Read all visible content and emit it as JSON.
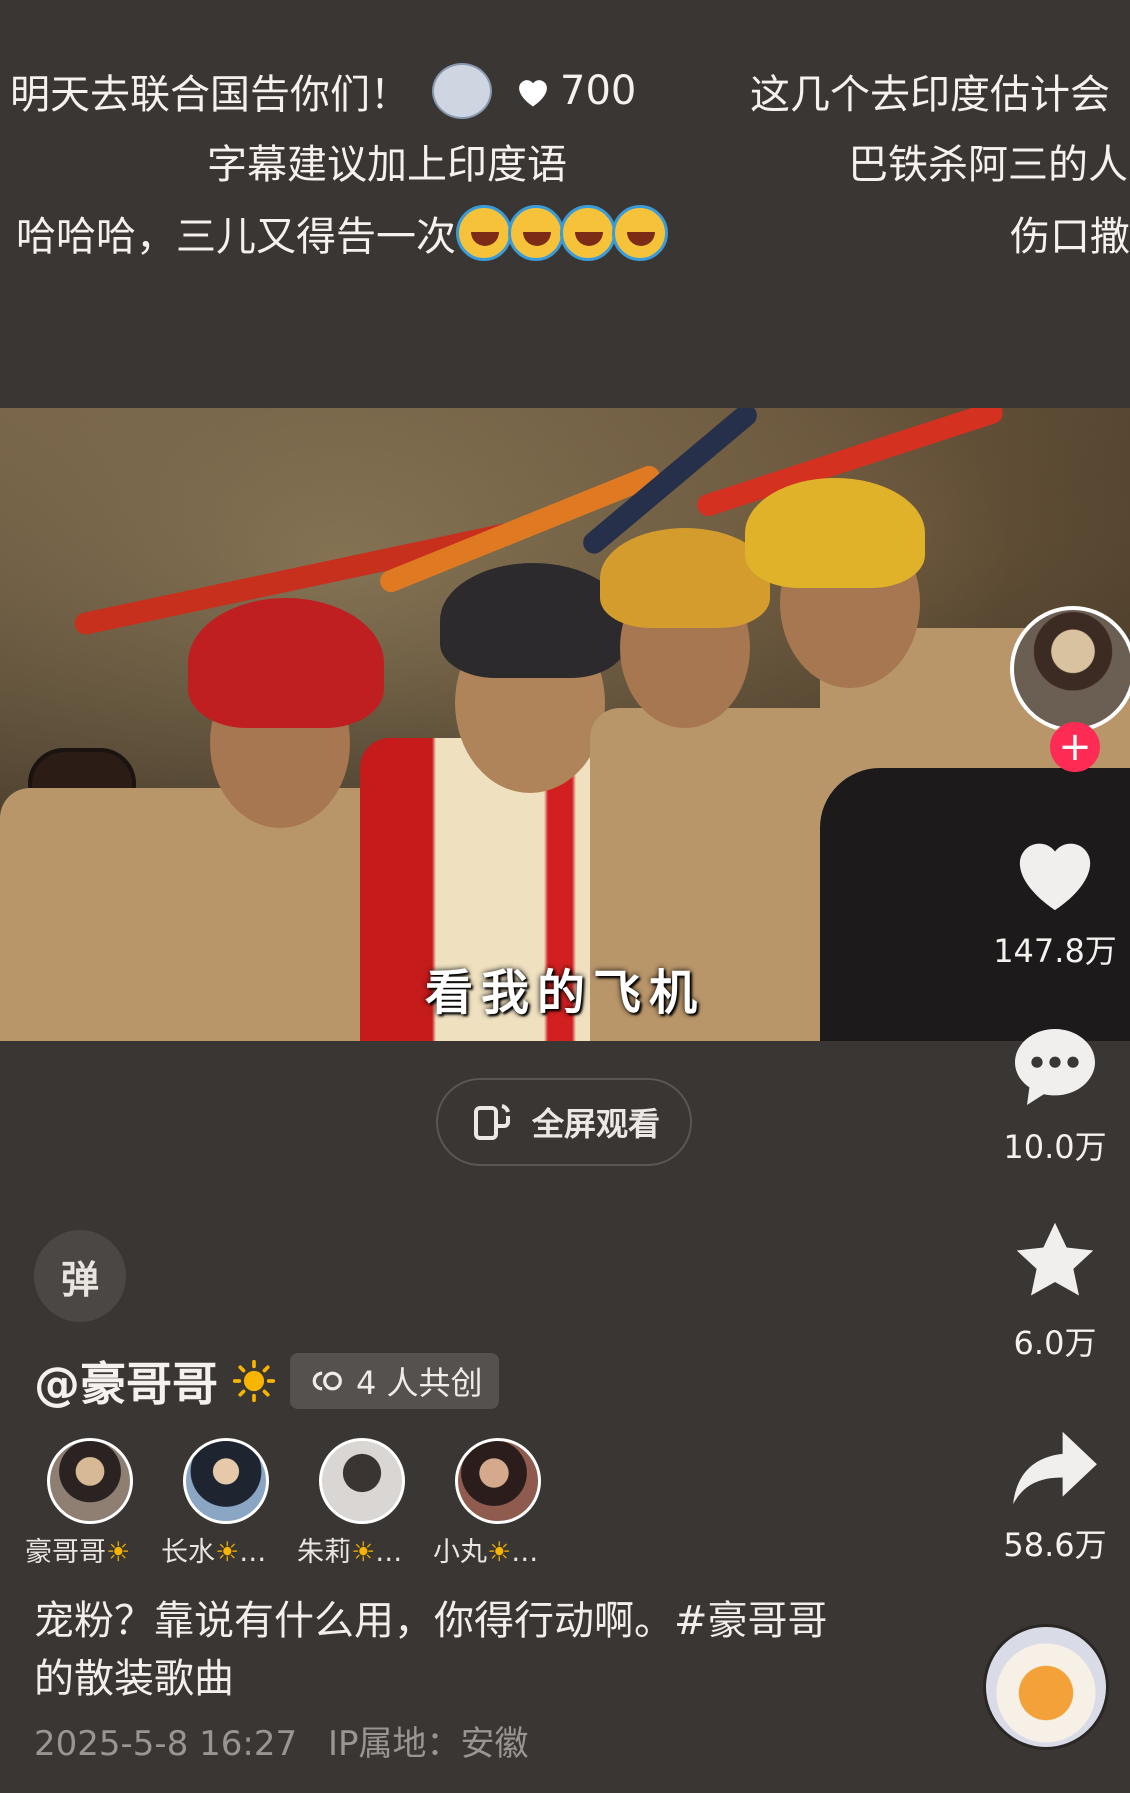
{
  "danmaku": [
    {
      "text": "明天去联合国告你们！",
      "likes": "700"
    },
    {
      "text": "这几个去印度估计会"
    },
    {
      "text": "字幕建议加上印度语"
    },
    {
      "text": "巴铁杀阿三的人"
    },
    {
      "text": "哈哈哈，三儿又得告一次"
    },
    {
      "text": "伤口撒"
    }
  ],
  "video": {
    "caption": "看我的飞机",
    "fullscreen_label": "全屏观看"
  },
  "actions": {
    "like_count": "147.8万",
    "comment_count": "10.0万",
    "favorite_count": "6.0万",
    "share_count": "58.6万",
    "follow_symbol": "+"
  },
  "danmu_toggle_label": "弹",
  "author": {
    "name": "@豪哥哥",
    "cocreate_label": "4 人共创"
  },
  "creators": [
    {
      "name": "豪哥哥"
    },
    {
      "name": "长水"
    },
    {
      "name": "朱莉"
    },
    {
      "name": "小丸"
    }
  ],
  "description": "宠粉？靠说有什么用，你得行动啊。#豪哥哥的散装歌曲",
  "meta": {
    "datetime": "2025-5-8 16:27",
    "ip_location": "IP属地：安徽"
  },
  "colors": {
    "background": "#3a3634",
    "follow": "#fe2c55",
    "sun": "#f7b500"
  },
  "icons": [
    "heart-icon",
    "comment-icon",
    "star-icon",
    "share-icon",
    "fullscreen-icon",
    "cocreate-icon",
    "sun-icon",
    "laugh-emoji",
    "wolf-emoji"
  ]
}
